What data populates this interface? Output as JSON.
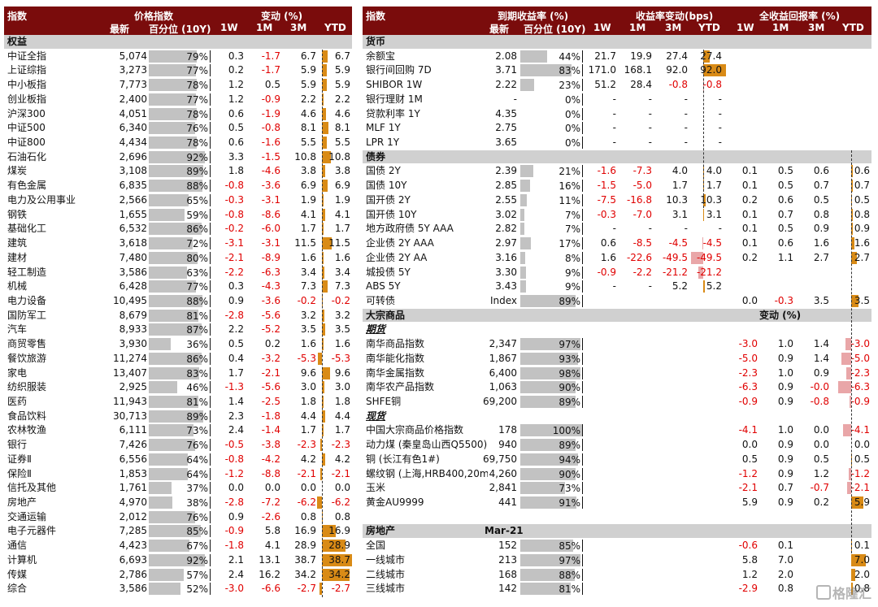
{
  "colors": {
    "header_bg": "#7a0c0c",
    "section_bg": "#d0d0d0",
    "bar_gray": "#c2c2c2",
    "bar_orange": "#d98b16",
    "bar_pink": "#e9a6a8",
    "negative": "#e00000"
  },
  "left": {
    "header": {
      "col_index": "指数",
      "col_price": "价格指数",
      "col_change": "变动 (%)",
      "sub_latest": "最新",
      "sub_pct": "百分位 (10Y)",
      "sub_1w": "1W",
      "sub_1m": "1M",
      "sub_3m": "3M",
      "sub_ytd": "YTD"
    },
    "section_label": "权益",
    "rows": [
      {
        "name": "中证全指",
        "latest": "5,074",
        "pct": 79,
        "w1": "0.3",
        "m1": "-1.7",
        "m3": "6.7",
        "ytd": "6.7"
      },
      {
        "name": "上证综指",
        "latest": "3,273",
        "pct": 77,
        "w1": "0.2",
        "m1": "-1.7",
        "m3": "5.9",
        "ytd": "5.9"
      },
      {
        "name": "中小板指",
        "latest": "7,773",
        "pct": 78,
        "w1": "1.2",
        "m1": "0.5",
        "m3": "5.9",
        "ytd": "5.9"
      },
      {
        "name": "创业板指",
        "latest": "2,400",
        "pct": 77,
        "w1": "1.2",
        "m1": "-0.9",
        "m3": "2.2",
        "ytd": "2.2"
      },
      {
        "name": "沪深300",
        "latest": "4,051",
        "pct": 78,
        "w1": "0.6",
        "m1": "-1.9",
        "m3": "4.6",
        "ytd": "4.6"
      },
      {
        "name": "中证500",
        "latest": "6,340",
        "pct": 76,
        "w1": "0.5",
        "m1": "-0.8",
        "m3": "8.1",
        "ytd": "8.1"
      },
      {
        "name": "中证800",
        "latest": "4,434",
        "pct": 78,
        "w1": "0.6",
        "m1": "-1.6",
        "m3": "5.5",
        "ytd": "5.5"
      },
      {
        "name": "石油石化",
        "latest": "2,696",
        "pct": 92,
        "w1": "3.3",
        "m1": "-1.5",
        "m3": "10.8",
        "ytd": "10.8"
      },
      {
        "name": "煤炭",
        "latest": "3,108",
        "pct": 89,
        "w1": "1.8",
        "m1": "-4.6",
        "m3": "3.8",
        "ytd": "3.8"
      },
      {
        "name": "有色金属",
        "latest": "6,835",
        "pct": 88,
        "w1": "-0.8",
        "m1": "-3.6",
        "m3": "6.9",
        "ytd": "6.9"
      },
      {
        "name": "电力及公用事业",
        "latest": "2,566",
        "pct": 65,
        "w1": "-0.3",
        "m1": "-3.1",
        "m3": "1.9",
        "ytd": "1.9"
      },
      {
        "name": "钢铁",
        "latest": "1,655",
        "pct": 59,
        "w1": "-0.8",
        "m1": "-8.6",
        "m3": "4.1",
        "ytd": "4.1"
      },
      {
        "name": "基础化工",
        "latest": "6,532",
        "pct": 86,
        "w1": "-0.2",
        "m1": "-6.0",
        "m3": "1.7",
        "ytd": "1.7"
      },
      {
        "name": "建筑",
        "latest": "3,618",
        "pct": 72,
        "w1": "-3.1",
        "m1": "-3.1",
        "m3": "11.5",
        "ytd": "11.5"
      },
      {
        "name": "建材",
        "latest": "7,480",
        "pct": 80,
        "w1": "-2.1",
        "m1": "-8.9",
        "m3": "1.6",
        "ytd": "1.6"
      },
      {
        "name": "轻工制造",
        "latest": "3,586",
        "pct": 63,
        "w1": "-2.2",
        "m1": "-6.3",
        "m3": "3.4",
        "ytd": "3.4"
      },
      {
        "name": "机械",
        "latest": "6,428",
        "pct": 77,
        "w1": "0.3",
        "m1": "-4.3",
        "m3": "7.3",
        "ytd": "7.3"
      },
      {
        "name": "电力设备",
        "latest": "10,495",
        "pct": 88,
        "w1": "0.9",
        "m1": "-3.6",
        "m3": "-0.2",
        "ytd": "-0.2"
      },
      {
        "name": "国防军工",
        "latest": "8,679",
        "pct": 81,
        "w1": "-2.8",
        "m1": "-5.6",
        "m3": "3.2",
        "ytd": "3.2"
      },
      {
        "name": "汽车",
        "latest": "8,933",
        "pct": 87,
        "w1": "2.2",
        "m1": "-5.2",
        "m3": "3.5",
        "ytd": "3.5"
      },
      {
        "name": "商贸零售",
        "latest": "3,930",
        "pct": 36,
        "w1": "0.5",
        "m1": "0.2",
        "m3": "1.6",
        "ytd": "1.6"
      },
      {
        "name": "餐饮旅游",
        "latest": "11,274",
        "pct": 86,
        "w1": "0.4",
        "m1": "-3.2",
        "m3": "-5.3",
        "ytd": "-5.3"
      },
      {
        "name": "家电",
        "latest": "13,407",
        "pct": 83,
        "w1": "1.7",
        "m1": "-2.1",
        "m3": "9.6",
        "ytd": "9.6"
      },
      {
        "name": "纺织服装",
        "latest": "2,925",
        "pct": 46,
        "w1": "-1.3",
        "m1": "-5.6",
        "m3": "3.0",
        "ytd": "3.0"
      },
      {
        "name": "医药",
        "latest": "11,943",
        "pct": 81,
        "w1": "1.4",
        "m1": "-2.5",
        "m3": "1.8",
        "ytd": "1.8"
      },
      {
        "name": "食品饮料",
        "latest": "30,713",
        "pct": 89,
        "w1": "2.3",
        "m1": "-1.8",
        "m3": "4.4",
        "ytd": "4.4"
      },
      {
        "name": "农林牧渔",
        "latest": "6,111",
        "pct": 73,
        "w1": "2.4",
        "m1": "-1.4",
        "m3": "1.7",
        "ytd": "1.7"
      },
      {
        "name": "银行",
        "latest": "7,426",
        "pct": 76,
        "w1": "-0.5",
        "m1": "-3.8",
        "m3": "-2.3",
        "ytd": "-2.3"
      },
      {
        "name": "证券Ⅱ",
        "latest": "6,556",
        "pct": 64,
        "w1": "-0.8",
        "m1": "-4.2",
        "m3": "4.2",
        "ytd": "4.2"
      },
      {
        "name": "保险Ⅱ",
        "latest": "1,853",
        "pct": 64,
        "w1": "-1.2",
        "m1": "-8.8",
        "m3": "-2.1",
        "ytd": "-2.1"
      },
      {
        "name": "信托及其他",
        "latest": "1,761",
        "pct": 37,
        "w1": "0.0",
        "m1": "0.0",
        "m3": "0.0",
        "ytd": "0.0"
      },
      {
        "name": "房地产",
        "latest": "4,970",
        "pct": 38,
        "w1": "-2.8",
        "m1": "-7.2",
        "m3": "-6.2",
        "ytd": "-6.2"
      },
      {
        "name": "交通运输",
        "latest": "2,012",
        "pct": 76,
        "w1": "0.9",
        "m1": "-2.6",
        "m3": "0.8",
        "ytd": "0.8"
      },
      {
        "name": "电子元器件",
        "latest": "7,285",
        "pct": 85,
        "w1": "-0.9",
        "m1": "5.8",
        "m3": "16.9",
        "ytd": "16.9"
      },
      {
        "name": "通信",
        "latest": "4,423",
        "pct": 67,
        "w1": "-1.8",
        "m1": "4.1",
        "m3": "28.9",
        "ytd": "28.9"
      },
      {
        "name": "计算机",
        "latest": "6,693",
        "pct": 92,
        "w1": "2.1",
        "m1": "13.1",
        "m3": "38.7",
        "ytd": "38.7"
      },
      {
        "name": "传媒",
        "latest": "2,786",
        "pct": 57,
        "w1": "2.4",
        "m1": "16.2",
        "m3": "34.2",
        "ytd": "34.2"
      },
      {
        "name": "综合",
        "latest": "3,586",
        "pct": 52,
        "w1": "-3.0",
        "m1": "-6.6",
        "m3": "-2.7",
        "ytd": "-2.7"
      }
    ]
  },
  "right": {
    "header": {
      "col_index": "指数",
      "col_yield": "到期收益率 (%)",
      "col_change": "收益率变动(bps)",
      "col_total": "全收益回报率 (%)",
      "sub_latest": "最新",
      "sub_pct": "百分位 (10Y)",
      "sub_1w": "1W",
      "sub_1m": "1M",
      "sub_3m": "3M",
      "sub_ytd": "YTD",
      "sub2_1w": "1W",
      "sub2_1m": "1M",
      "sub2_3m": "3M",
      "sub2_ytd": "YTD"
    },
    "rows": [
      {
        "kind": "section",
        "name": "货币"
      },
      {
        "kind": "data",
        "name": "余额宝",
        "latest": "2.08",
        "pct": 44,
        "c1w": "21.7",
        "c1m": "19.9",
        "c3m": "27.4",
        "cytd": "27.4",
        "cytd_v": 27.4
      },
      {
        "kind": "data",
        "name": "银行间回购 7D",
        "latest": "3.71",
        "pct": 83,
        "c1w": "171.0",
        "c1m": "168.1",
        "c3m": "92.0",
        "cytd": "92.0",
        "cytd_v": 92.0
      },
      {
        "kind": "data",
        "name": "SHIBOR 1W",
        "latest": "2.22",
        "pct": 23,
        "c1w": "51.2",
        "c1m": "28.4",
        "c3m": "-0.8",
        "cytd": "-0.8",
        "cytd_v": -0.8
      },
      {
        "kind": "data",
        "name": "银行理财 1M",
        "latest": "-",
        "pct": 0,
        "c1w": "-",
        "c1m": "-",
        "c3m": "-",
        "cytd": "-"
      },
      {
        "kind": "data",
        "name": "贷款利率 1Y",
        "latest": "4.35",
        "pct": 0,
        "c1w": "-",
        "c1m": "-",
        "c3m": "-",
        "cytd": "-"
      },
      {
        "kind": "data",
        "name": "MLF 1Y",
        "latest": "2.75",
        "pct": 0,
        "c1w": "-",
        "c1m": "-",
        "c3m": "-",
        "cytd": "-"
      },
      {
        "kind": "data",
        "name": "LPR 1Y",
        "latest": "3.65",
        "pct": 0,
        "c1w": "-",
        "c1m": "-",
        "c3m": "-",
        "cytd": "-"
      },
      {
        "kind": "section",
        "name": "债券"
      },
      {
        "kind": "data",
        "name": "国债 2Y",
        "latest": "2.39",
        "pct": 21,
        "c1w": "-1.6",
        "c1m": "-7.3",
        "c3m": "4.0",
        "cytd": "4.0",
        "cytd_v": 4.0,
        "t1w": "0.1",
        "t1m": "0.5",
        "t3m": "0.6",
        "tytd": "0.6",
        "tytd_v": 0.6
      },
      {
        "kind": "data",
        "name": "国债 10Y",
        "latest": "2.85",
        "pct": 16,
        "c1w": "-1.5",
        "c1m": "-5.0",
        "c3m": "1.7",
        "cytd": "1.7",
        "cytd_v": 1.7,
        "t1w": "0.1",
        "t1m": "0.5",
        "t3m": "0.7",
        "tytd": "0.7",
        "tytd_v": 0.7
      },
      {
        "kind": "data",
        "name": "国开债 2Y",
        "latest": "2.55",
        "pct": 11,
        "c1w": "-7.5",
        "c1m": "-16.8",
        "c3m": "10.3",
        "cytd": "10.3",
        "cytd_v": 10.3,
        "t1w": "0.2",
        "t1m": "0.6",
        "t3m": "0.5",
        "tytd": "0.5",
        "tytd_v": 0.5
      },
      {
        "kind": "data",
        "name": "国开债 10Y",
        "latest": "3.02",
        "pct": 7,
        "c1w": "-0.3",
        "c1m": "-7.0",
        "c3m": "3.1",
        "cytd": "3.1",
        "cytd_v": 3.1,
        "t1w": "0.1",
        "t1m": "0.7",
        "t3m": "0.8",
        "tytd": "0.8",
        "tytd_v": 0.8
      },
      {
        "kind": "data",
        "name": "地方政府债 5Y AAA",
        "latest": "2.82",
        "pct": 7,
        "c1w": "-",
        "c1m": "-",
        "c3m": "-",
        "cytd": "-",
        "t1w": "0.1",
        "t1m": "0.5",
        "t3m": "0.9",
        "tytd": "0.9",
        "tytd_v": 0.9
      },
      {
        "kind": "data",
        "name": "企业债 2Y AAA",
        "latest": "2.97",
        "pct": 17,
        "c1w": "0.6",
        "c1m": "-8.5",
        "c3m": "-4.5",
        "cytd": "-4.5",
        "cytd_v": -4.5,
        "t1w": "0.1",
        "t1m": "0.6",
        "t3m": "1.6",
        "tytd": "1.6",
        "tytd_v": 1.6
      },
      {
        "kind": "data",
        "name": "企业债 2Y AA",
        "latest": "3.16",
        "pct": 8,
        "c1w": "1.6",
        "c1m": "-22.6",
        "c3m": "-49.5",
        "cytd": "-49.5",
        "cytd_v": -49.5,
        "t1w": "0.2",
        "t1m": "1.1",
        "t3m": "2.7",
        "tytd": "2.7",
        "tytd_v": 2.7
      },
      {
        "kind": "data",
        "name": "城投债 5Y",
        "latest": "3.30",
        "pct": 9,
        "c1w": "-0.9",
        "c1m": "-2.2",
        "c3m": "-21.2",
        "cytd": "-21.2",
        "cytd_v": -21.2
      },
      {
        "kind": "data",
        "name": "ABS 5Y",
        "latest": "3.43",
        "pct": 9,
        "c1w": "-",
        "c1m": "-",
        "c3m": "5.2",
        "cytd": "5.2",
        "cytd_v": 5.2
      },
      {
        "kind": "data",
        "name": "可转债",
        "latest": "Index",
        "pct": 89,
        "t1w": "0.0",
        "t1m": "-0.3",
        "t3m": "3.5",
        "tytd": "3.5",
        "tytd_v": 3.5
      },
      {
        "kind": "section",
        "name": "大宗商品",
        "right_label": "变动 (%)"
      },
      {
        "kind": "sub",
        "name": "期货"
      },
      {
        "kind": "data",
        "name": "南华商品指数",
        "latest": "2,347",
        "pct": 97,
        "t1w": "-3.0",
        "t1m": "1.0",
        "t3m": "1.4",
        "tytd": "-3.0",
        "tytd_v": -3.0
      },
      {
        "kind": "data",
        "name": "南华能化指数",
        "latest": "1,867",
        "pct": 93,
        "t1w": "-5.0",
        "t1m": "0.9",
        "t3m": "1.4",
        "tytd": "-5.0",
        "tytd_v": -5.0
      },
      {
        "kind": "data",
        "name": "南华金属指数",
        "latest": "6,400",
        "pct": 98,
        "t1w": "-2.3",
        "t1m": "1.0",
        "t3m": "0.9",
        "tytd": "-2.3",
        "tytd_v": -2.3
      },
      {
        "kind": "data",
        "name": "南华农产品指数",
        "latest": "1,063",
        "pct": 90,
        "t1w": "-6.3",
        "t1m": "0.9",
        "t3m": "-0.0",
        "tytd": "-6.3",
        "tytd_v": -6.3
      },
      {
        "kind": "data",
        "name": "SHFE铜",
        "latest": "69,200",
        "pct": 89,
        "t1w": "-0.9",
        "t1m": "0.9",
        "t3m": "-0.8",
        "tytd": "-0.9",
        "tytd_v": -0.9
      },
      {
        "kind": "sub",
        "name": "现货"
      },
      {
        "kind": "data",
        "name": "中国大宗商品价格指数",
        "latest": "178",
        "pct": 100,
        "t1w": "-4.1",
        "t1m": "1.0",
        "t3m": "0.0",
        "tytd": "-4.1",
        "tytd_v": -4.1
      },
      {
        "kind": "data",
        "name": "动力煤 (秦皇岛山西Q5500)",
        "latest": "940",
        "pct": 89,
        "t1w": "0.0",
        "t1m": "0.9",
        "t3m": "0.0",
        "tytd": "0.0",
        "tytd_v": 0.0
      },
      {
        "kind": "data",
        "name": "铜 (长江有色1#)",
        "latest": "69,750",
        "pct": 94,
        "t1w": "0.5",
        "t1m": "0.9",
        "t3m": "0.5",
        "tytd": "0.5",
        "tytd_v": 0.5
      },
      {
        "kind": "data",
        "name": "螺纹钢 (上海,HRB400,20mm",
        "latest": "4,260",
        "pct": 90,
        "t1w": "-1.2",
        "t1m": "0.9",
        "t3m": "1.2",
        "tytd": "-1.2",
        "tytd_v": -1.2
      },
      {
        "kind": "data",
        "name": "玉米",
        "latest": "2,841",
        "pct": 73,
        "t1w": "-2.1",
        "t1m": "0.7",
        "t3m": "-0.7",
        "tytd": "-2.1",
        "tytd_v": -2.1
      },
      {
        "kind": "data",
        "name": "黄金AU9999",
        "latest": "441",
        "pct": 91,
        "t1w": "5.9",
        "t1m": "0.9",
        "t3m": "0.2",
        "tytd": "5.9",
        "tytd_v": 5.9
      },
      {
        "kind": "blank"
      },
      {
        "kind": "section",
        "name": "房地产",
        "date_label": "Mar-21"
      },
      {
        "kind": "data",
        "name": "全国",
        "latest": "152",
        "pct": 85,
        "t1w": "-0.6",
        "t1m": "0.1",
        "tytd": "0.1",
        "tytd_v": 0.1
      },
      {
        "kind": "data",
        "name": "一线城市",
        "latest": "213",
        "pct": 97,
        "t1w": "5.8",
        "t1m": "7.0",
        "tytd": "7.0",
        "tytd_v": 7.0
      },
      {
        "kind": "data",
        "name": "二线城市",
        "latest": "168",
        "pct": 88,
        "t1w": "1.2",
        "t1m": "2.0",
        "tytd": "2.0",
        "tytd_v": 2.0
      },
      {
        "kind": "data",
        "name": "三线城市",
        "latest": "142",
        "pct": 81,
        "t1w": "-2.9",
        "t1m": "0.8",
        "tytd": "0.8",
        "tytd_v": 0.8
      }
    ]
  },
  "watermark": "格隆汇"
}
